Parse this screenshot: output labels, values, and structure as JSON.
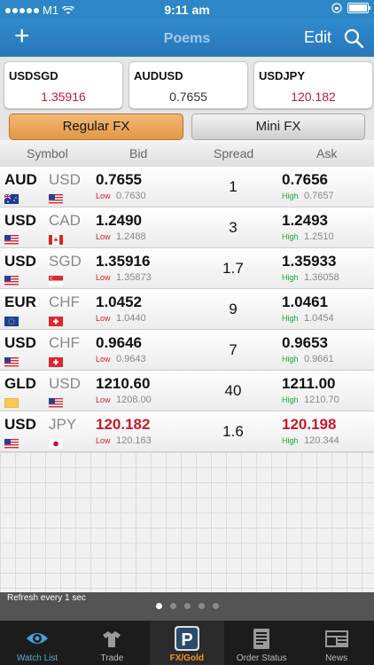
{
  "status": {
    "carrier": "M1",
    "time": "9:11 am"
  },
  "nav": {
    "title": "Poems",
    "edit_label": "Edit"
  },
  "quotes": [
    {
      "symbol": "USDSGD",
      "value": "1.35916",
      "color": "#c51a2e"
    },
    {
      "symbol": "AUDUSD",
      "value": "0.7655",
      "color": "#333333"
    },
    {
      "symbol": "USDJPY",
      "value": "120.182",
      "color": "#c51a2e"
    }
  ],
  "segments": {
    "regular": "Regular FX",
    "mini": "Mini FX"
  },
  "columns": {
    "symbol": "Symbol",
    "bid": "Bid",
    "spread": "Spread",
    "ask": "Ask"
  },
  "rows": [
    {
      "base": "AUD",
      "quote": "USD",
      "bid": "0.7655",
      "low_label": "Low",
      "low": "0.7630",
      "spread": "1",
      "ask": "0.7656",
      "high_label": "High",
      "high": "0.7657",
      "flag_base": "AU",
      "flag_quote": "US",
      "highlight": false
    },
    {
      "base": "USD",
      "quote": "CAD",
      "bid": "1.2490",
      "low_label": "Low",
      "low": "1.2488",
      "spread": "3",
      "ask": "1.2493",
      "high_label": "High",
      "high": "1.2510",
      "flag_base": "US",
      "flag_quote": "CA",
      "highlight": false
    },
    {
      "base": "USD",
      "quote": "SGD",
      "bid": "1.35916",
      "low_label": "Low",
      "low": "1.35873",
      "spread": "1.7",
      "ask": "1.35933",
      "high_label": "High",
      "high": "1.36058",
      "flag_base": "US",
      "flag_quote": "SG",
      "highlight": false
    },
    {
      "base": "EUR",
      "quote": "CHF",
      "bid": "1.0452",
      "low_label": "Low",
      "low": "1.0440",
      "spread": "9",
      "ask": "1.0461",
      "high_label": "High",
      "high": "1.0454",
      "flag_base": "EU",
      "flag_quote": "CH",
      "highlight": false
    },
    {
      "base": "USD",
      "quote": "CHF",
      "bid": "0.9646",
      "low_label": "Low",
      "low": "0.9643",
      "spread": "7",
      "ask": "0.9653",
      "high_label": "High",
      "high": "0.9661",
      "flag_base": "US",
      "flag_quote": "CH",
      "highlight": false
    },
    {
      "base": "GLD",
      "quote": "USD",
      "bid": "1210.60",
      "low_label": "Low",
      "low": "1208.00",
      "spread": "40",
      "ask": "1211.00",
      "high_label": "High",
      "high": "1210.70",
      "flag_base": "GOLD",
      "flag_quote": "US",
      "highlight": false
    },
    {
      "base": "USD",
      "quote": "JPY",
      "bid": "120.182",
      "low_label": "Low",
      "low": "120.163",
      "spread": "1.6",
      "ask": "120.198",
      "high_label": "High",
      "high": "120.344",
      "flag_base": "US",
      "flag_quote": "JP",
      "highlight": true
    }
  ],
  "footer": {
    "refresh": "Refresh every 1 sec",
    "page_count": 5,
    "current_page": 1
  },
  "tabs": [
    {
      "label": "Watch List",
      "icon": "eye-icon",
      "active": false
    },
    {
      "label": "Trade",
      "icon": "trade-icon",
      "active": false
    },
    {
      "label": "FX/Gold",
      "icon": "poems-p-icon",
      "active": true
    },
    {
      "label": "Order Status",
      "icon": "clipboard-icon",
      "active": false
    },
    {
      "label": "News",
      "icon": "newspaper-icon",
      "active": false
    }
  ],
  "colors": {
    "brand_blue": "#2d86c6",
    "accent_orange": "#f0961e",
    "price_red": "#c51a2e",
    "high_green": "#1aa33d"
  }
}
